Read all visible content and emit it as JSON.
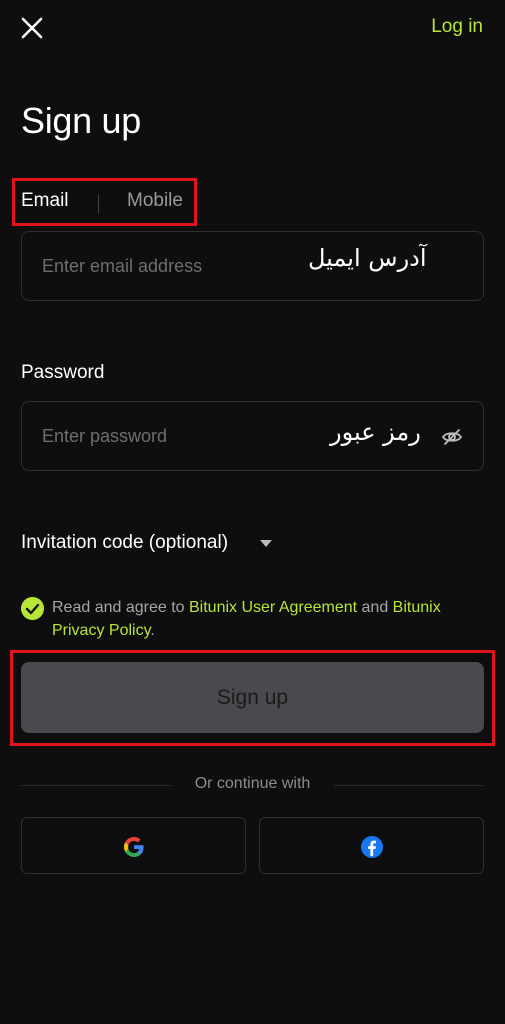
{
  "header": {
    "close_icon": "close-icon",
    "login_label": "Log in"
  },
  "page": {
    "title": "Sign up"
  },
  "tabs": {
    "email_label": "Email",
    "mobile_label": "Mobile",
    "active": "Email"
  },
  "email": {
    "placeholder": "Enter email address",
    "value": "",
    "annotation": "آدرس ایمیل"
  },
  "password": {
    "label": "Password",
    "placeholder": "Enter password",
    "value": "",
    "annotation": "رمز عبور",
    "toggle_icon": "eye-off-icon"
  },
  "invitation": {
    "label": "Invitation code (optional)",
    "caret_icon": "caret-down-icon"
  },
  "agreement": {
    "checked": true,
    "prefix": "Read and agree to ",
    "user_agreement": "Bitunix User Agreement",
    "middle": " and ",
    "privacy_policy": "Bitunix Privacy Policy",
    "suffix": "."
  },
  "actions": {
    "signup_label": "Sign up"
  },
  "social": {
    "divider_text": "Or continue with",
    "providers": [
      "google-icon",
      "facebook-icon"
    ]
  },
  "colors": {
    "background": "#0e0e0e",
    "accent": "#b8e636",
    "highlight_box": "#e0141b",
    "button_disabled": "#4a4a4e"
  }
}
